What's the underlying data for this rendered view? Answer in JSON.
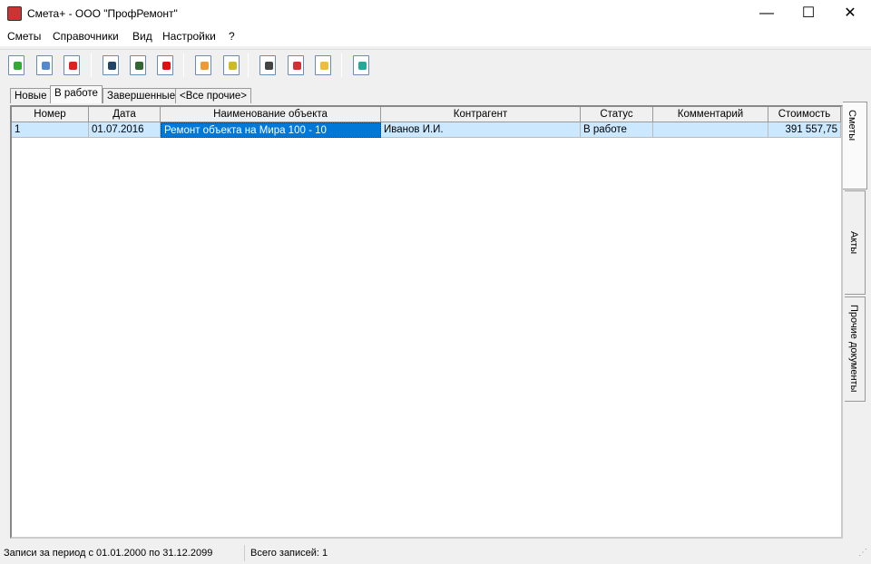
{
  "window": {
    "title": "Смета+ - ООО \"ПрофРемонт\"",
    "minimize": "—",
    "maximize": "☐",
    "close": "✕"
  },
  "menu": [
    "Сметы",
    "Справочники",
    "Вид",
    "Настройки",
    "?"
  ],
  "toolbar": [
    {
      "icon": "new-document-icon",
      "color": "#3a3"
    },
    {
      "icon": "edit-document-icon",
      "color": "#58c"
    },
    {
      "icon": "delete-document-icon",
      "color": "#d22"
    },
    {
      "icon": "date-range-icon",
      "color": "#246"
    },
    {
      "icon": "checklist-icon",
      "color": "#363"
    },
    {
      "icon": "warning-document-icon",
      "color": "#d11"
    },
    {
      "icon": "contractors-icon",
      "color": "#e93"
    },
    {
      "icon": "money-icon",
      "color": "#cb2"
    },
    {
      "icon": "print-icon",
      "color": "#444"
    },
    {
      "icon": "export-pdf-icon",
      "color": "#c33"
    },
    {
      "icon": "transfer-icon",
      "color": "#eb4"
    },
    {
      "icon": "exit-icon",
      "color": "#2a9"
    }
  ],
  "tabs": [
    "Новые",
    "В работе",
    "Завершенные",
    "<Все прочие>"
  ],
  "active_tab": 1,
  "table": {
    "columns": [
      "Номер",
      "Дата",
      "Наименование объекта",
      "Контрагент",
      "Статус",
      "Комментарий",
      "Стоимость"
    ],
    "rows": [
      [
        "1",
        "01.07.2016",
        "Ремонт объекта на Мира 100 - 10",
        "Иванов И.И.",
        "В работе",
        "",
        "391 557,75"
      ]
    ]
  },
  "side_tabs": [
    "Сметы",
    "Акты",
    "Прочие документы"
  ],
  "status": {
    "period": "Записи за период с 01.01.2000 по 31.12.2099",
    "count": "Всего записей: 1"
  }
}
